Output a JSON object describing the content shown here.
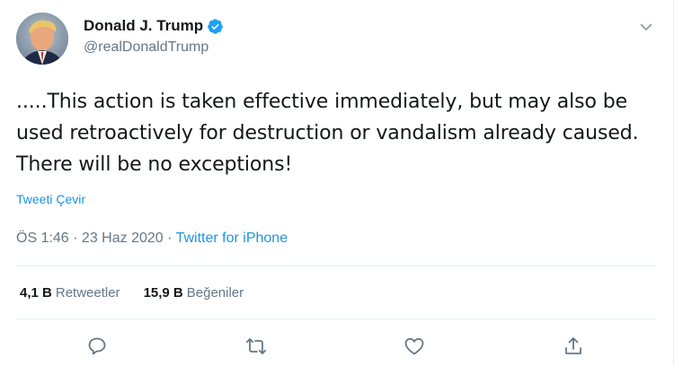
{
  "author": {
    "display_name": "Donald J. Trump",
    "handle": "@realDonaldTrump",
    "verified": true
  },
  "tweet": {
    "text": ".....This action is taken effective immediately, but may also be used retroactively for destruction or vandalism already caused. There will be no exceptions!",
    "translate_label": "Tweeti Çevir",
    "time": "ÖS 1:46",
    "date": "23 Haz 2020",
    "separator": " · ",
    "source": "Twitter for iPhone"
  },
  "stats": {
    "retweets_count": "4,1 B",
    "retweets_label": "Retweetler",
    "likes_count": "15,9 B",
    "likes_label": "Beğeniler"
  },
  "colors": {
    "link": "#1b95e0",
    "secondary_text": "#657786",
    "verified_badge": "#1da1f2",
    "divider": "#e6ecf0"
  },
  "icons": [
    "verified-badge-icon",
    "chevron-down-icon",
    "reply-icon",
    "retweet-icon",
    "like-icon",
    "share-icon"
  ]
}
